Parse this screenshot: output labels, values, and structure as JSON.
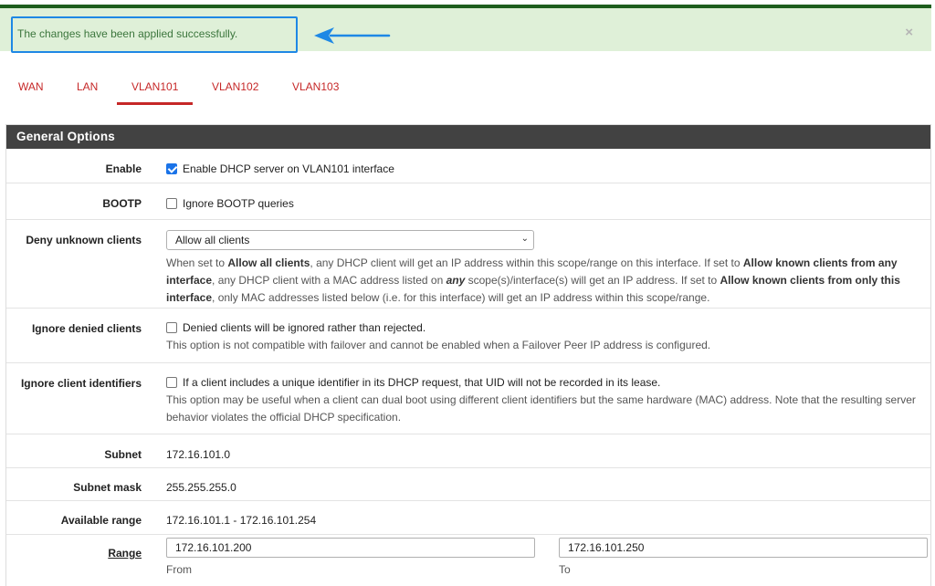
{
  "alert": {
    "message": "The changes have been applied successfully.",
    "close_symbol": "×"
  },
  "tabs": [
    {
      "label": "WAN",
      "active": false
    },
    {
      "label": "LAN",
      "active": false
    },
    {
      "label": "VLAN101",
      "active": true
    },
    {
      "label": "VLAN102",
      "active": false
    },
    {
      "label": "VLAN103",
      "active": false
    }
  ],
  "panel": {
    "heading": "General Options",
    "enable": {
      "label": "Enable",
      "checkbox_label": "Enable DHCP server on VLAN101 interface",
      "checked": true
    },
    "bootp": {
      "label": "BOOTP",
      "checkbox_label": "Ignore BOOTP queries",
      "checked": false
    },
    "deny_unknown": {
      "label": "Deny unknown clients",
      "selected": "Allow all clients",
      "help": {
        "p1": "When set to ",
        "b1": "Allow all clients",
        "p2": ", any DHCP client will get an IP address within this scope/range on this interface. If set to ",
        "b2": "Allow known clients from any interface",
        "p3": ", any DHCP client with a MAC address listed on ",
        "b3": "any",
        "p4": " scope(s)/interface(s) will get an IP address. If set to ",
        "b4": "Allow known clients from only this interface",
        "p5": ", only MAC addresses listed below (i.e. for this interface) will get an IP address within this scope/range."
      }
    },
    "ignore_denied": {
      "label": "Ignore denied clients",
      "checkbox_label": "Denied clients will be ignored rather than rejected.",
      "checked": false,
      "help": "This option is not compatible with failover and cannot be enabled when a Failover Peer IP address is configured."
    },
    "ignore_client_ids": {
      "label": "Ignore client identifiers",
      "checkbox_label": "If a client includes a unique identifier in its DHCP request, that UID will not be recorded in its lease.",
      "checked": false,
      "help": "This option may be useful when a client can dual boot using different client identifiers but the same hardware (MAC) address. Note that the resulting server behavior violates the official DHCP specification."
    },
    "subnet": {
      "label": "Subnet",
      "value": "172.16.101.0"
    },
    "subnet_mask": {
      "label": "Subnet mask",
      "value": "255.255.255.0"
    },
    "available_range": {
      "label": "Available range",
      "value": "172.16.101.1 - 172.16.101.254"
    },
    "range": {
      "label": "Range",
      "from_value": "172.16.101.200",
      "from_label": "From",
      "to_value": "172.16.101.250",
      "to_label": "To"
    }
  },
  "colors": {
    "accent_red": "#c62828",
    "alert_bg": "#dff0d8",
    "alert_text": "#3c763d",
    "annotation_blue": "#1e88e5",
    "heading_bg": "#424242"
  }
}
